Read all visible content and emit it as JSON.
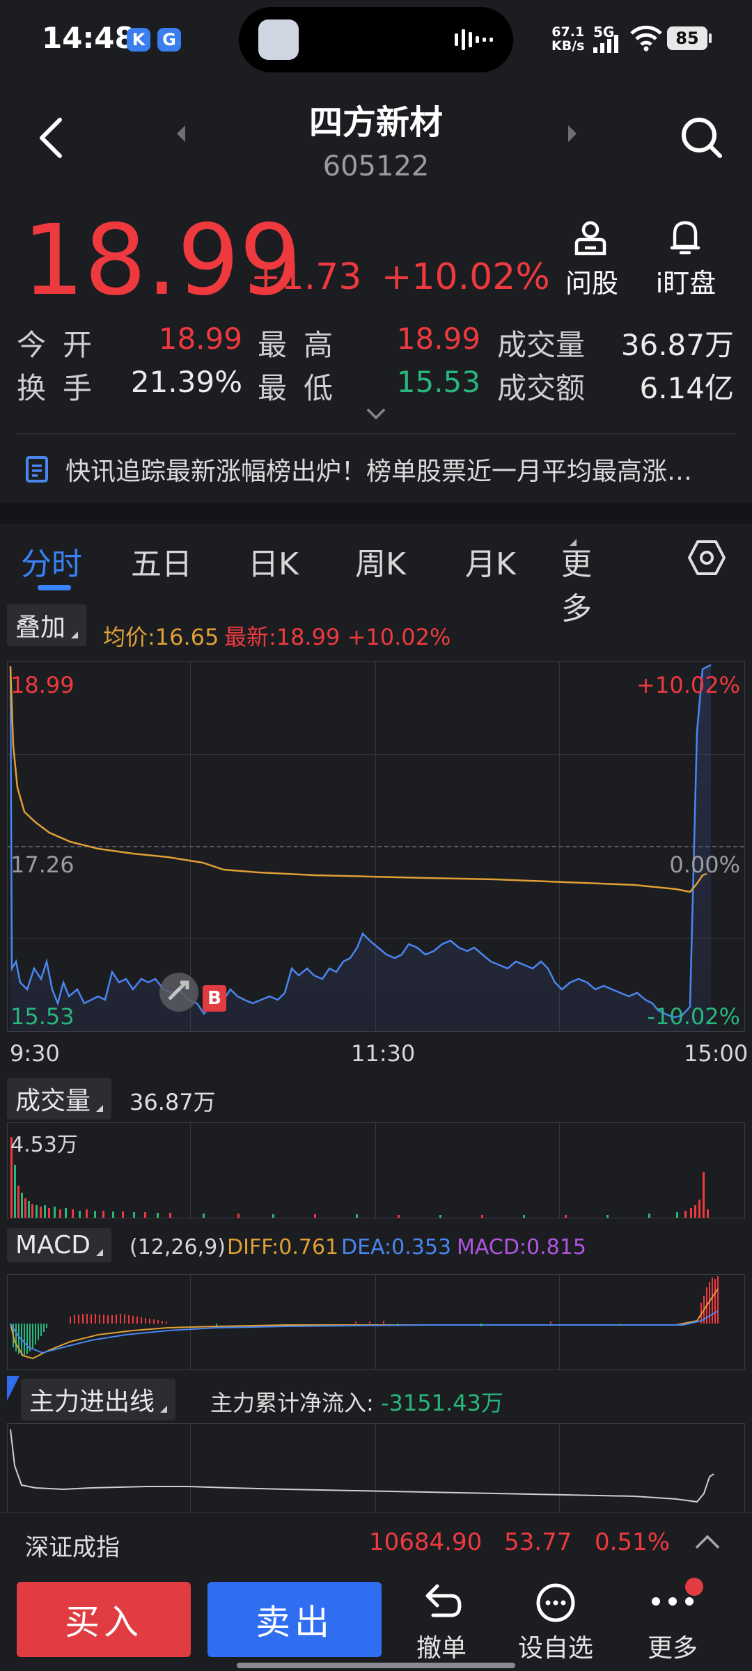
{
  "status": {
    "time": "14:48",
    "net_speed_top": "67.1",
    "net_speed_bottom": "KB/s",
    "network": "5G",
    "battery": "85"
  },
  "header": {
    "stock_name": "四方新材",
    "stock_code": "605122",
    "ask_label": "问股",
    "watch_label": "i盯盘"
  },
  "quote": {
    "price": "18.99",
    "change": "+1.73",
    "change_pct": "+10.02%",
    "open_label": "今开",
    "open_value": "18.99",
    "high_label": "最高",
    "high_value": "18.99",
    "volume_label": "成交量",
    "volume_value": "36.87万",
    "turnover_label": "换手",
    "turnover_value": "21.39%",
    "low_label": "最低",
    "low_value": "15.53",
    "amount_label": "成交额",
    "amount_value": "6.14亿"
  },
  "news": {
    "text": "快讯追踪最新涨幅榜出炉！榜单股票近一月平均最高涨…"
  },
  "tabs": [
    "分时",
    "五日",
    "日K",
    "周K",
    "月K",
    "更多"
  ],
  "overlay": {
    "label": "叠加",
    "avg_text": "均价:16.65",
    "latest_text": "最新:18.99 +10.02%"
  },
  "price_chart": {
    "top_left": "18.99",
    "top_right": "+10.02%",
    "mid_left": "17.26",
    "mid_right": "0.00%",
    "bottom_left": "15.53",
    "bottom_right": "-10.02%",
    "time_start": "9:30",
    "time_mid": "11:30",
    "time_end": "15:00",
    "marker_b": "B"
  },
  "volume": {
    "label": "成交量",
    "total": "36.87万",
    "max_label": "4.53万"
  },
  "macd": {
    "label": "MACD",
    "params": "(12,26,9)",
    "diff": "DIFF:0.761",
    "dea": "DEA:0.353",
    "macd": "MACD:0.815"
  },
  "main_flow": {
    "label": "主力进出线",
    "text_label": "主力累计净流入:",
    "value": "-3151.43万"
  },
  "index_bar": {
    "name": "深证成指",
    "value": "10684.90",
    "change": "53.77",
    "pct": "0.51%"
  },
  "bottom": {
    "buy": "买入",
    "sell": "卖出",
    "cancel": "撤单",
    "set_fav": "设自选",
    "more": "更多"
  },
  "colors": {
    "up": "#ee3a3f",
    "down": "#27b77c",
    "avg_line": "#e0a034",
    "price_line": "#4a86f0"
  }
}
